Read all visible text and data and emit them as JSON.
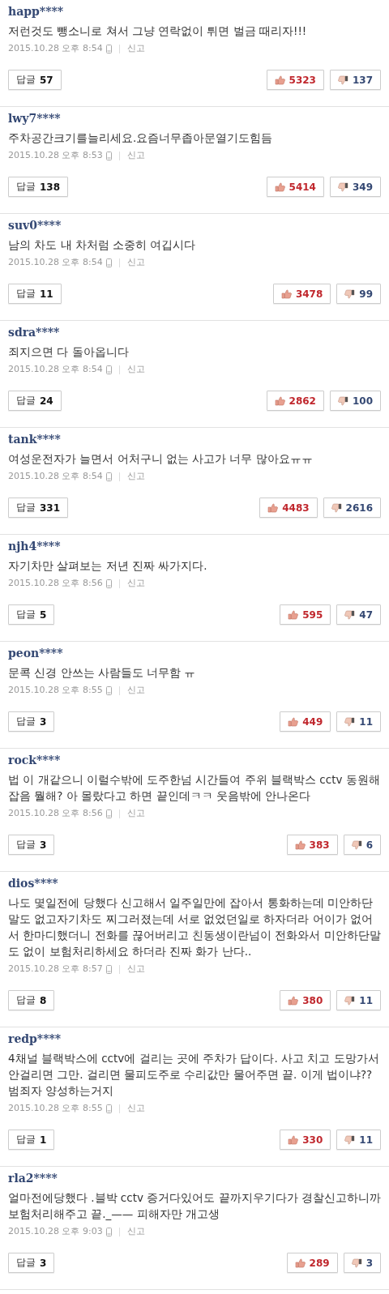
{
  "comments": [
    {
      "user": "happ****",
      "text": "저런것도 뺑소니로 쳐서 그냥 연락없이 튀면 벌금 때리자!!!",
      "time": "2015.10.28 오후 8:54",
      "report": "신고",
      "reply_label": "답글",
      "replies": "57",
      "likes": "5323",
      "dislikes": "137"
    },
    {
      "user": "lwy7****",
      "text": "주차공간크기를늘리세요.요즘너무좁아문열기도힘듬",
      "time": "2015.10.28 오후 8:53",
      "report": "신고",
      "reply_label": "답글",
      "replies": "138",
      "likes": "5414",
      "dislikes": "349"
    },
    {
      "user": "suv0****",
      "text": "남의 차도 내 차처럼 소중히 여깁시다",
      "time": "2015.10.28 오후 8:54",
      "report": "신고",
      "reply_label": "답글",
      "replies": "11",
      "likes": "3478",
      "dislikes": "99"
    },
    {
      "user": "sdra****",
      "text": "죄지으면 다 돌아옵니다",
      "time": "2015.10.28 오후 8:54",
      "report": "신고",
      "reply_label": "답글",
      "replies": "24",
      "likes": "2862",
      "dislikes": "100"
    },
    {
      "user": "tank****",
      "text": "여성운전자가 늘면서 어처구니 없는 사고가 너무 많아요ㅠㅠ",
      "time": "2015.10.28 오후 8:54",
      "report": "신고",
      "reply_label": "답글",
      "replies": "331",
      "likes": "4483",
      "dislikes": "2616"
    },
    {
      "user": "njh4****",
      "text": "자기차만 살펴보는 저년 진짜 싸가지다.",
      "time": "2015.10.28 오후 8:56",
      "report": "신고",
      "reply_label": "답글",
      "replies": "5",
      "likes": "595",
      "dislikes": "47"
    },
    {
      "user": "peon****",
      "text": "문콕 신경 안쓰는 사람들도 너무함 ㅠ",
      "time": "2015.10.28 오후 8:55",
      "report": "신고",
      "reply_label": "답글",
      "replies": "3",
      "likes": "449",
      "dislikes": "11"
    },
    {
      "user": "rock****",
      "text": "법 이 개같으니 이럴수밖에 도주한넘 시간들여 주위 블랙박스 cctv 동원해 잡음 뭘해? 아 몰랐다고 하면 끝인데ㅋㅋ 웃음밖에 안나온다",
      "time": "2015.10.28 오후 8:56",
      "report": "신고",
      "reply_label": "답글",
      "replies": "3",
      "likes": "383",
      "dislikes": "6"
    },
    {
      "user": "dios****",
      "text": "나도 몇일전에 당했다 신고해서 일주일만에 잡아서 통화하는데 미안하단말도 없고자기차도 찌그러졌는데 서로 없었던일로 하자더라 어이가 없어서 한마디했더니 전화를 끊어버리고 친동생이란넘이 전화와서 미안하단말도 없이 보험처리하세요 하더라 진짜 화가 난다..",
      "time": "2015.10.28 오후 8:57",
      "report": "신고",
      "reply_label": "답글",
      "replies": "8",
      "likes": "380",
      "dislikes": "11"
    },
    {
      "user": "redp****",
      "text": "4채널 블랙박스에 cctv에 걸리는 곳에 주차가 답이다. 사고 치고 도망가서 안걸리면 그만. 걸리면 물피도주로 수리값만 물어주면 끝. 이게 법이냐?? 범죄자 양성하는거지",
      "time": "2015.10.28 오후 8:55",
      "report": "신고",
      "reply_label": "답글",
      "replies": "1",
      "likes": "330",
      "dislikes": "11"
    },
    {
      "user": "rla2****",
      "text": "얼마전에당했다 .블박 cctv 증거다있어도 끝까지우기다가 경찰신고하니까 보험처리해주고 끝._—— 피해자만 개고생",
      "time": "2015.10.28 오후 9:03",
      "report": "신고",
      "reply_label": "답글",
      "replies": "3",
      "likes": "289",
      "dislikes": "3"
    }
  ]
}
